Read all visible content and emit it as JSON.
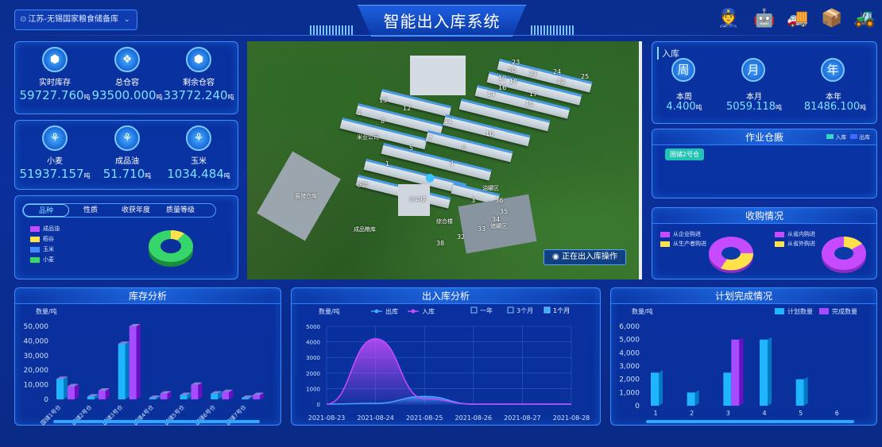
{
  "header": {
    "location": "江苏-无锡国家粮食储备库",
    "title": "智能出入库系统",
    "icons": [
      "police-badge-icon",
      "robot-icon",
      "truck-icon",
      "box-icon",
      "forklift-icon"
    ]
  },
  "stock_summary": {
    "items": [
      {
        "label": "实时库存",
        "value": "59727.760",
        "unit": "吨",
        "icon": "cube-icon"
      },
      {
        "label": "总仓容",
        "value": "93500.000",
        "unit": "吨",
        "icon": "grains-icon"
      },
      {
        "label": "剩余仓容",
        "value": "33772.240",
        "unit": "吨",
        "icon": "cube-icon"
      }
    ]
  },
  "grain_summary": {
    "items": [
      {
        "label": "小麦",
        "value": "51937.157",
        "unit": "吨",
        "icon": "wheat-icon"
      },
      {
        "label": "成品油",
        "value": "51.710",
        "unit": "吨",
        "icon": "wheat-icon"
      },
      {
        "label": "玉米",
        "value": "1034.484",
        "unit": "吨",
        "icon": "wheat-icon"
      }
    ]
  },
  "variety_panel": {
    "tabs": [
      "品种",
      "性质",
      "收获年度",
      "质量等级"
    ],
    "legend": [
      {
        "name": "成品油",
        "color": "#c64bff"
      },
      {
        "name": "稻谷",
        "color": "#ffe14a"
      },
      {
        "name": "玉米",
        "color": "#3f8cff"
      },
      {
        "name": "小麦",
        "color": "#37d66b"
      }
    ]
  },
  "map": {
    "status": "正在出入库操作",
    "warehouse_numbers": [
      "23",
      "20",
      "21",
      "24",
      "25",
      "19",
      "18",
      "22",
      "16",
      "14",
      "17",
      "13",
      "12",
      "15",
      "9",
      "8",
      "11",
      "10",
      "7",
      "6",
      "5",
      "4",
      "1",
      "3",
      "36",
      "35",
      "34",
      "32",
      "33",
      "38"
    ],
    "labels": [
      "办公楼",
      "米业公司",
      "展储仓库",
      "综合楼",
      "成品粮库",
      "铁路",
      "油罐区",
      "储罐区"
    ]
  },
  "inbound_panel": {
    "title": "入库",
    "items": [
      {
        "icon_char": "周",
        "label": "本周",
        "value": "4.400",
        "unit": "吨"
      },
      {
        "icon_char": "月",
        "label": "本月",
        "value": "5059.118",
        "unit": "吨"
      },
      {
        "icon_char": "年",
        "label": "本年",
        "value": "81486.100",
        "unit": "吨"
      }
    ]
  },
  "work_warehouse": {
    "title": "作业仓廒",
    "legend_in": "入库",
    "legend_out": "出库",
    "active_tag": "国储2号仓"
  },
  "purchase_panel": {
    "title": "收购情况",
    "legend_left": [
      {
        "name": "从企业购进",
        "color": "#c64bff"
      },
      {
        "name": "从生产者购进",
        "color": "#ffe14a"
      }
    ],
    "legend_right": [
      {
        "name": "从省内购进",
        "color": "#c64bff"
      },
      {
        "name": "从省外购进",
        "color": "#ffe14a"
      }
    ]
  },
  "chart_data": [
    {
      "type": "bar",
      "title": "库存分析",
      "ylabel": "数量/吨",
      "ylim": [
        0,
        50000
      ],
      "yticks": [
        "50,000",
        "40,000",
        "30,000",
        "20,000",
        "10,000",
        "0"
      ],
      "categories": [
        "国储1号仓",
        "国储2号仓",
        "国储3号仓",
        "国储4号仓",
        "国储5号仓",
        "国储6号仓",
        "国储7号仓"
      ],
      "series": [
        {
          "values": [
            14000,
            2000,
            38000,
            1000,
            3000,
            4000,
            1000
          ],
          "color": "#1fb6ff"
        },
        {
          "values": [
            9000,
            6000,
            50000,
            4000,
            10000,
            5000,
            3000
          ],
          "color": "#a64bff"
        }
      ]
    },
    {
      "type": "area",
      "title": "出入库分析",
      "ylabel": "数量/吨",
      "ylim": [
        0,
        5000
      ],
      "yticks": [
        "5000",
        "4000",
        "3000",
        "2000",
        "1000",
        "0"
      ],
      "x": [
        "2021-08-23",
        "2021-08-24",
        "2021-08-25",
        "2021-08-26",
        "2021-08-27",
        "2021-08-28"
      ],
      "series": [
        {
          "name": "出库",
          "values": [
            0,
            50,
            500,
            0,
            0,
            0
          ],
          "color": "#3fa9ff"
        },
        {
          "name": "入库",
          "values": [
            0,
            4200,
            350,
            0,
            0,
            0
          ],
          "color": "#c64bff"
        }
      ],
      "range_options": [
        "一年",
        "3个月",
        "1个月"
      ],
      "range_selected": "1个月"
    },
    {
      "type": "bar",
      "title": "计划完成情况",
      "ylabel": "数量/吨",
      "ylim": [
        0,
        6000
      ],
      "yticks": [
        "6,000",
        "5,000",
        "4,000",
        "3,000",
        "2,000",
        "1,000",
        "0"
      ],
      "categories": [
        "1",
        "2",
        "3",
        "4",
        "5",
        "6"
      ],
      "series": [
        {
          "name": "计划数量",
          "values": [
            2500,
            1000,
            2500,
            5000,
            2000,
            0
          ],
          "color": "#1fb6ff"
        },
        {
          "name": "完成数量",
          "values": [
            0,
            0,
            5000,
            0,
            0,
            0
          ],
          "color": "#a64bff"
        }
      ]
    }
  ]
}
